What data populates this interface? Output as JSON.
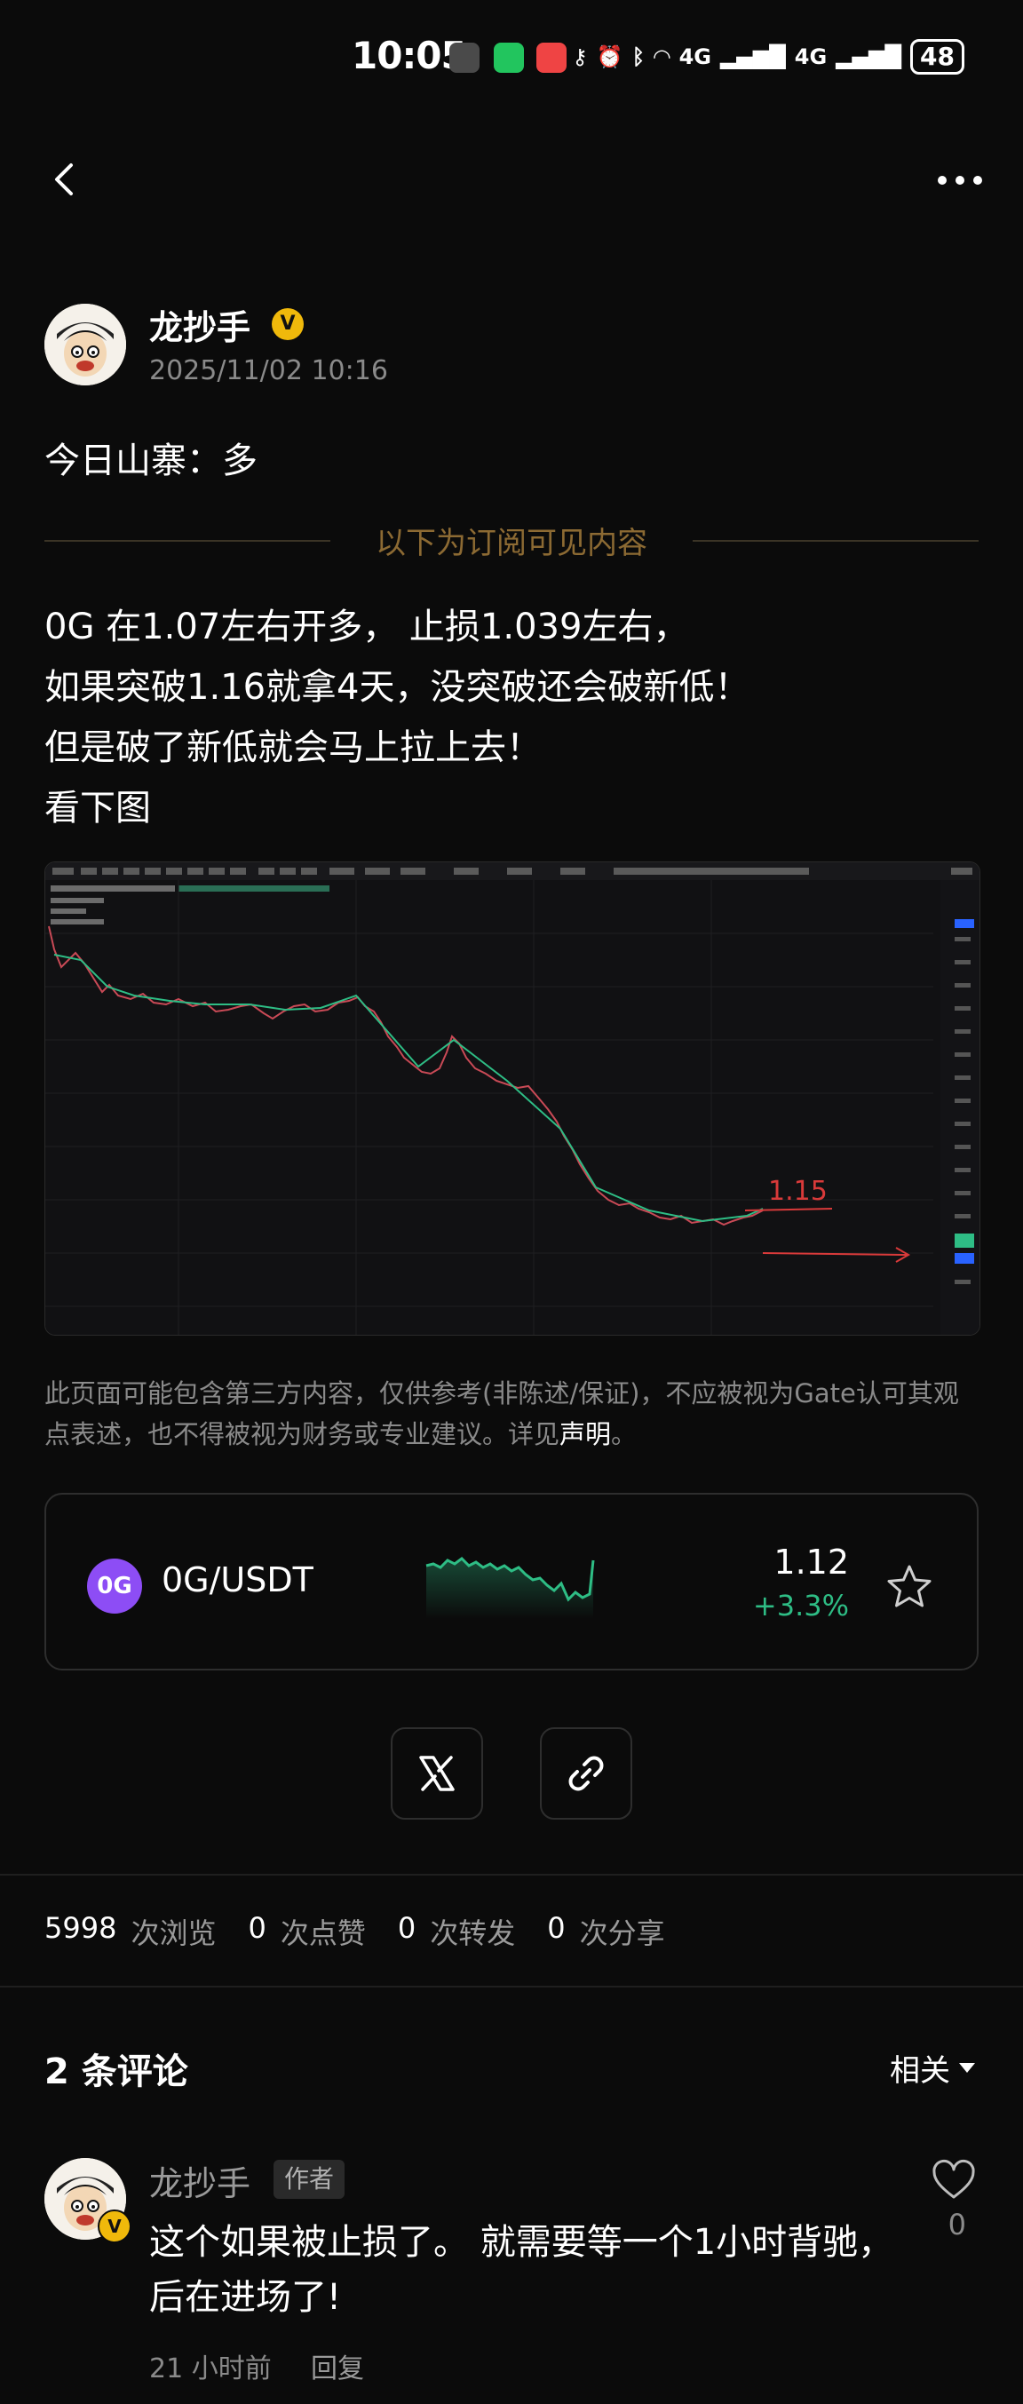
{
  "status_bar": {
    "time": "10:05",
    "network": "4G",
    "battery": "48"
  },
  "post": {
    "author": "龙抄手",
    "verified_badge": "V",
    "date": "2025/11/02 10:16",
    "intro": "今日山寨：多",
    "subscriber_divider": "以下为订阅可见内容",
    "lines": [
      "0G  在1.07左右开多，  止损1.039左右，",
      "如果突破1.16就拿4天，没突破还会破新低！",
      "但是破了新低就会马上拉上去！",
      "看下图"
    ],
    "chart_annotation": "1.15"
  },
  "disclaimer": {
    "text": "此页面可能包含第三方内容，仅供参考(非陈述/保证)，不应被视为Gate认可其观点表述，也不得被视为财务或专业建议。详见",
    "link": "声明",
    "end": "。"
  },
  "ticker": {
    "logo_text": "0G",
    "pair": "0G/USDT",
    "price": "1.12",
    "change": "+3.3%",
    "change_color": "#2ebd85"
  },
  "stats": {
    "views": "5998",
    "views_label": "次浏览",
    "likes": "0",
    "likes_label": "次点赞",
    "reposts": "0",
    "reposts_label": "次转发",
    "shares": "0",
    "shares_label": "次分享"
  },
  "comments": {
    "title": "2 条评论",
    "sort": "相关",
    "items": [
      {
        "author": "龙抄手",
        "badge": "作者",
        "vbadge": "V",
        "text": "这个如果被止损了。 就需要等一个1小时背驰，后在进场了!",
        "time": "21 小时前",
        "reply": "回复",
        "likes": "0"
      }
    ]
  },
  "icons": {
    "back": "back-arrow-icon",
    "more": "more-dots-icon",
    "star": "star-icon",
    "x": "x-logo-icon",
    "link": "link-icon",
    "heart": "heart-icon"
  }
}
